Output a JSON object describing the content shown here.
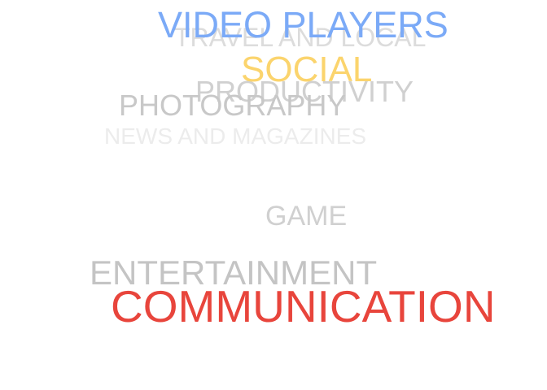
{
  "word_cloud": {
    "words": [
      {
        "key": "travel",
        "text": "TRAVEL AND LOCAL",
        "color": "#dcdcdc"
      },
      {
        "key": "video",
        "text": "VIDEO PLAYERS",
        "color": "#7baaf7"
      },
      {
        "key": "productivity",
        "text": "PRODUCTIVITY",
        "color": "#d0d0d0"
      },
      {
        "key": "photography",
        "text": "PHOTOGRAPHY",
        "color": "#c8c8c8"
      },
      {
        "key": "social",
        "text": "SOCIAL",
        "color": "#fbd46d"
      },
      {
        "key": "news",
        "text": "NEWS AND MAGAZINES",
        "color": "#ececec"
      },
      {
        "key": "game",
        "text": "GAME",
        "color": "#d0d0d0"
      },
      {
        "key": "entertainment",
        "text": "ENTERTAINMENT",
        "color": "#c4c4c4"
      },
      {
        "key": "communication",
        "text": "COMMUNICATION",
        "color": "#e8453c"
      }
    ]
  }
}
